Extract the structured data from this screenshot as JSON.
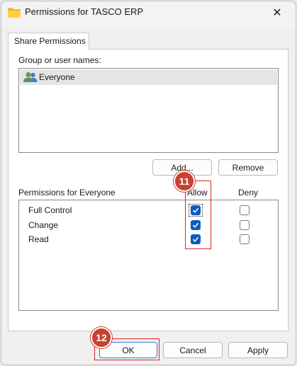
{
  "window": {
    "title": "Permissions for TASCO ERP",
    "close_glyph": "✕",
    "close_icon": "close-icon",
    "title_icon": "folder-icon"
  },
  "tab": {
    "label": "Share Permissions"
  },
  "groups": {
    "label": "Group or user names:",
    "items": [
      {
        "name": "Everyone",
        "icon": "users-icon"
      }
    ],
    "add_button": "Add...",
    "remove_button": "Remove"
  },
  "permissions": {
    "label": "Permissions for Everyone",
    "allow_header": "Allow",
    "deny_header": "Deny",
    "rows": [
      {
        "name": "Full Control",
        "allow": true,
        "deny": false
      },
      {
        "name": "Change",
        "allow": true,
        "deny": false
      },
      {
        "name": "Read",
        "allow": true,
        "deny": false
      }
    ]
  },
  "annotations": {
    "step_allow": "11",
    "step_ok": "12"
  },
  "footer": {
    "ok": "OK",
    "cancel": "Cancel",
    "apply": "Apply"
  },
  "colors": {
    "accent": "#0b5cbf",
    "highlight": "#d42a2a",
    "badge": "#c9412f"
  }
}
